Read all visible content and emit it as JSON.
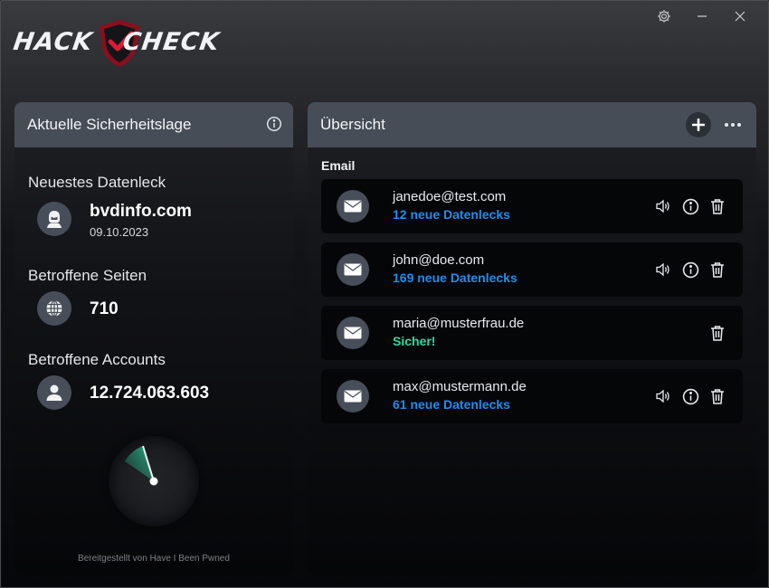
{
  "app": {
    "logo_left": "HACK",
    "logo_right": "CHECK"
  },
  "window_controls": {
    "settings_icon": "gear-icon",
    "minimize_icon": "minimize-icon",
    "close_icon": "close-icon"
  },
  "left_panel": {
    "title": "Aktuelle Sicherheitslage",
    "latest_breach": {
      "label": "Neuestes Datenleck",
      "name": "bvdinfo.com",
      "date": "09.10.2023",
      "icon": "hacker-icon"
    },
    "affected_sites": {
      "label": "Betroffene Seiten",
      "value": "710",
      "icon": "globe-icon"
    },
    "affected_accounts": {
      "label": "Betroffene Accounts",
      "value": "12.724.063.603",
      "icon": "user-icon"
    },
    "footer": "Bereitgestellt von Have I Been Pwned"
  },
  "right_panel": {
    "title": "Übersicht",
    "group_label": "Email",
    "emails": [
      {
        "address": "janedoe@test.com",
        "status": "12 neue Datenlecks",
        "state": "leak"
      },
      {
        "address": "john@doe.com",
        "status": "169 neue Datenlecks",
        "state": "leak"
      },
      {
        "address": "maria@musterfrau.de",
        "status": "Sicher!",
        "state": "safe"
      },
      {
        "address": "max@mustermann.de",
        "status": "61 neue Datenlecks",
        "state": "leak"
      }
    ]
  },
  "colors": {
    "accent_blue": "#1f8cf0",
    "safe_green": "#2fd9a0",
    "logo_red": "#d0182f",
    "header_bg": "#464d57"
  }
}
